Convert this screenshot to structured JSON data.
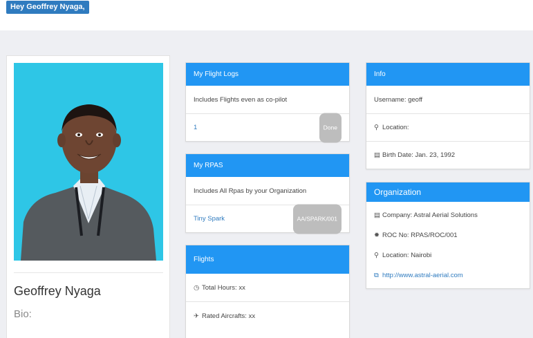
{
  "greeting": "Hey Geoffrey Nyaga,",
  "profile": {
    "name": "Geoffrey Nyaga",
    "bio_label": "Bio:",
    "bio_value": "- - -"
  },
  "flight_logs": {
    "title": "My Flight Logs",
    "description": "Includes Flights even as co-pilot",
    "count": "1",
    "badge": "Done"
  },
  "rpas": {
    "title": "My RPAS",
    "description": "Includes All Rpas by your Organization",
    "item": "Tiny Spark",
    "badge": "AA/SPARK/001"
  },
  "flights": {
    "title": "Flights",
    "total_hours": "Total Hours: xx",
    "rated_aircrafts": "Rated Aircrafts: xx"
  },
  "info": {
    "title": "Info",
    "username": "Username: geoff",
    "location": "Location:",
    "birth_date": "Birth Date: Jan. 23, 1992"
  },
  "organization": {
    "title": "Organization",
    "company": "Company: Astral Aerial Solutions",
    "roc": "ROC No: RPAS/ROC/001",
    "location": "Location: Nairobi",
    "website": "http://www.astral-aerial.com"
  },
  "colors": {
    "accent": "#2196f3",
    "greeting_bg": "#2f7bbf",
    "photo_bg": "#2ec6e6"
  },
  "icons": {
    "location": "map-marker-icon",
    "birth_date": "calendar-icon",
    "company": "building-icon",
    "roc": "certificate-icon",
    "website": "external-link-icon",
    "total_hours": "clock-icon",
    "rated_aircrafts": "plane-icon"
  }
}
